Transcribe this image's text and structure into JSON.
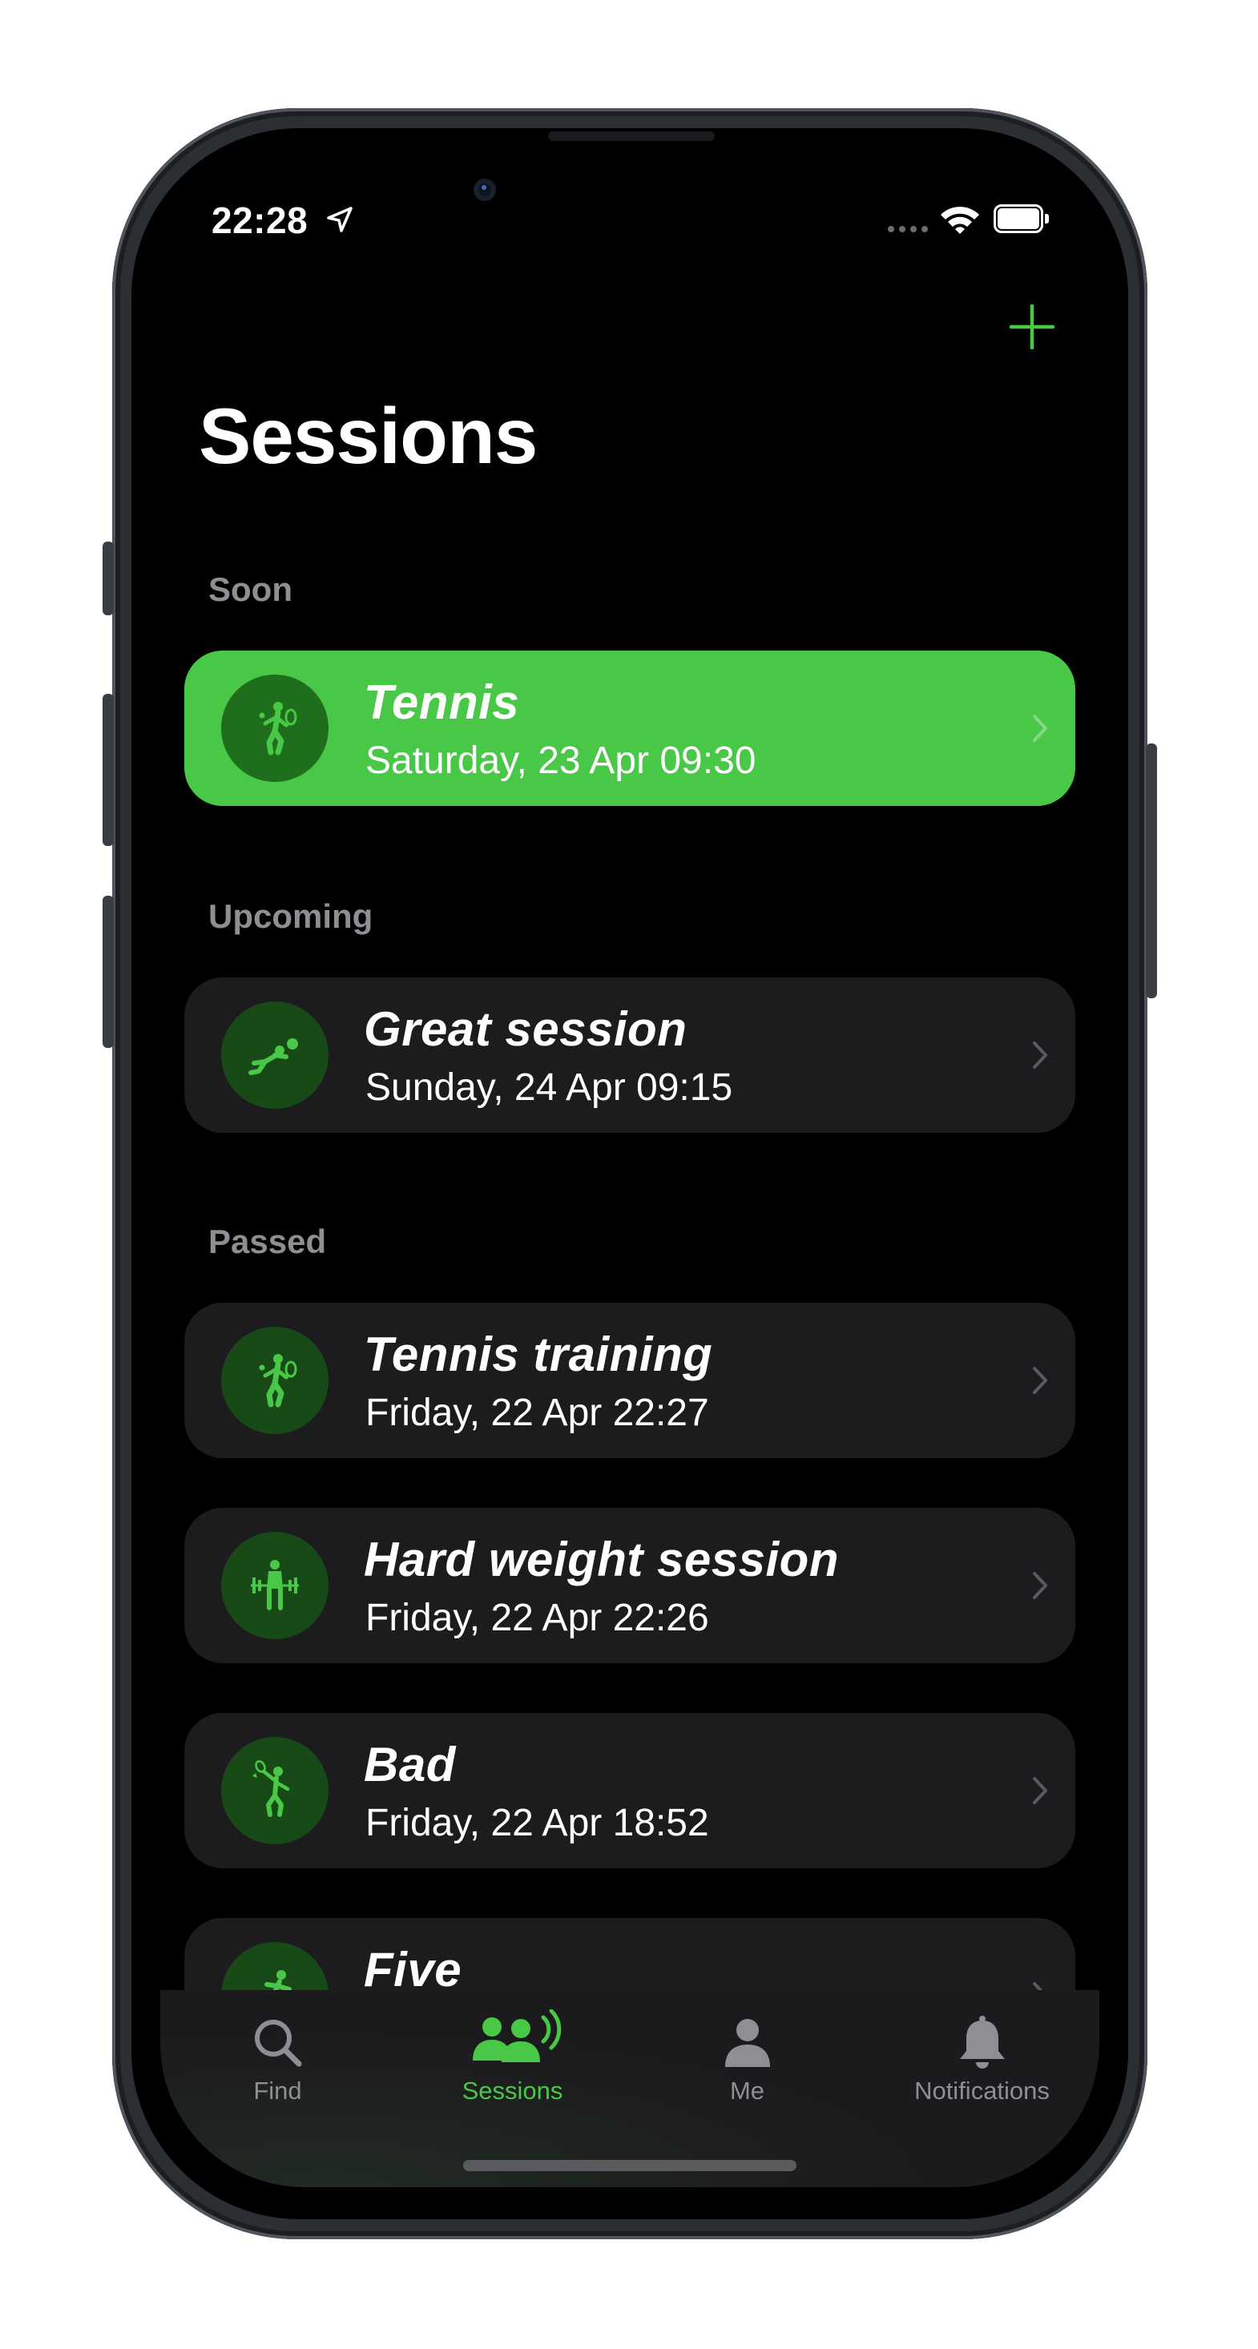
{
  "status_bar": {
    "time": "22:28"
  },
  "header": {
    "title": "Sessions",
    "add_icon": "plus-icon"
  },
  "colors": {
    "accent": "#48c846",
    "card": "#1c1c1e",
    "avatar": "#184a17",
    "background": "#000000",
    "secondary_text": "#8e8e93"
  },
  "sections": {
    "soon": {
      "header": "Soon",
      "items": [
        {
          "title": "Tennis",
          "date": "Saturday, 23 Apr 09:30",
          "icon": "tennis-icon"
        }
      ]
    },
    "upcoming": {
      "header": "Upcoming",
      "items": [
        {
          "title": "Great session",
          "date": "Sunday, 24 Apr 09:15",
          "icon": "volleyball-icon"
        }
      ]
    },
    "passed": {
      "header": "Passed",
      "items": [
        {
          "title": "Tennis training",
          "date": "Friday, 22 Apr 22:27",
          "icon": "tennis-icon"
        },
        {
          "title": "Hard weight session",
          "date": "Friday, 22 Apr 22:26",
          "icon": "weightlifting-icon"
        },
        {
          "title": "Bad",
          "date": "Friday, 22 Apr 18:52",
          "icon": "badminton-icon"
        },
        {
          "title": "Five",
          "date": "",
          "icon": "running-icon"
        }
      ]
    }
  },
  "tab_bar": {
    "tabs": [
      {
        "label": "Find",
        "icon": "search-icon",
        "active": false
      },
      {
        "label": "Sessions",
        "icon": "people-icon",
        "active": true
      },
      {
        "label": "Me",
        "icon": "person-icon",
        "active": false
      },
      {
        "label": "Notifications",
        "icon": "bell-icon",
        "active": false
      }
    ]
  }
}
